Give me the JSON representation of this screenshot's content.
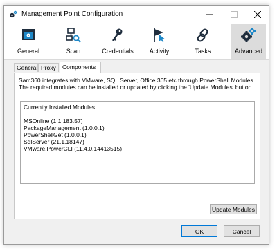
{
  "window": {
    "title": "Management Point Configuration"
  },
  "toolbar": {
    "items": [
      {
        "label": "General",
        "icon": "general-window-icon"
      },
      {
        "label": "Scan",
        "icon": "network-scan-icon"
      },
      {
        "label": "Credentials",
        "icon": "key-icon"
      },
      {
        "label": "Activity",
        "icon": "flag-cursor-icon"
      },
      {
        "label": "Tasks",
        "icon": "link-icon"
      },
      {
        "label": "Advanced",
        "icon": "gears-icon",
        "active": true
      }
    ]
  },
  "tabs": [
    {
      "label": "General"
    },
    {
      "label": "Proxy"
    },
    {
      "label": "Components",
      "active": true
    }
  ],
  "components": {
    "description": "Sam360 integrates with VMware, SQL Server, Office 365 etc through PowerShell Modules. The required modules can be installed or updated by clicking the 'Update Modules' button",
    "list_header": "Currently Installed Modules",
    "modules": [
      "MSOnline (1.1.183.57)",
      "PackageManagement (1.0.0.1)",
      "PowerShellGet (1.0.0.1)",
      "SqlServer (21.1.18147)",
      "VMware.PowerCLI (11.4.0.14413515)"
    ],
    "update_button": "Update Modules"
  },
  "footer": {
    "ok_label": "OK",
    "cancel_label": "Cancel"
  },
  "colors": {
    "accent": "#0078d7",
    "icon_dark": "#1f2d3d",
    "icon_blue": "#1e88c8"
  }
}
